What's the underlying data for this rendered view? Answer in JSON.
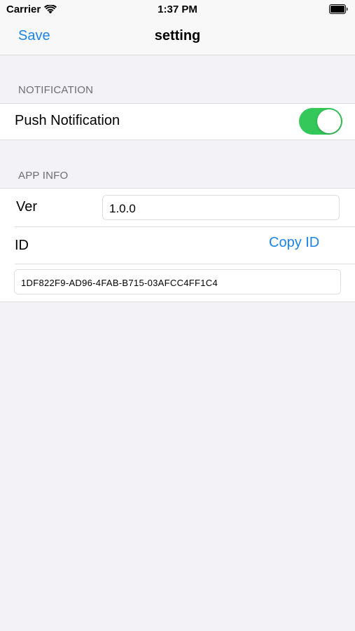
{
  "status_bar": {
    "carrier": "Carrier",
    "time": "1:37 PM"
  },
  "nav": {
    "save_label": "Save",
    "title": "setting"
  },
  "notification_section": {
    "header": "NOTIFICATION",
    "push_label": "Push Notification",
    "push_enabled": true
  },
  "app_info_section": {
    "header": "APP INFO",
    "version_label": "Ver",
    "version_value": "1.0.0",
    "id_label": "ID",
    "copy_id_label": "Copy ID",
    "id_value": "1DF822F9-AD96-4FAB-B715-03AFCC4FF1C4"
  },
  "icons": {
    "wifi": "wifi-icon",
    "battery": "battery-icon"
  },
  "colors": {
    "accent": "#1a84e8",
    "toggle_on": "#34c759",
    "background": "#f2f2f7"
  }
}
